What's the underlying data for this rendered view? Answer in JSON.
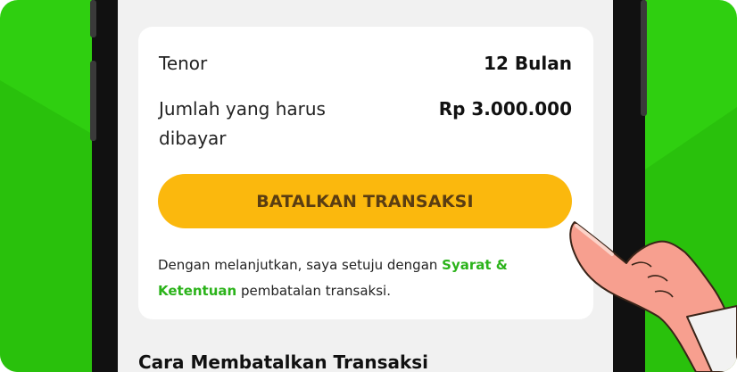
{
  "colors": {
    "background_green": "#2fcf10",
    "button_yellow": "#fbb80d",
    "link_green": "#2bb31a",
    "button_text": "#5a3d12"
  },
  "details": {
    "tenor_label": "Tenor",
    "tenor_value": "12 Bulan",
    "amount_label_line1": "Jumlah yang harus",
    "amount_label_line2": "dibayar",
    "amount_value": "Rp 3.000.000"
  },
  "cancel_button_label": "BATALKAN TRANSAKSI",
  "terms": {
    "prefix": "Dengan melanjutkan, saya setuju dengan ",
    "link_part1": "Syarat &",
    "link_part2": "Ketentuan",
    "suffix": " pembatalan transaksi."
  },
  "section_title": "Cara Membatalkan Transaksi",
  "icons": [
    "pointing-hand-icon"
  ]
}
